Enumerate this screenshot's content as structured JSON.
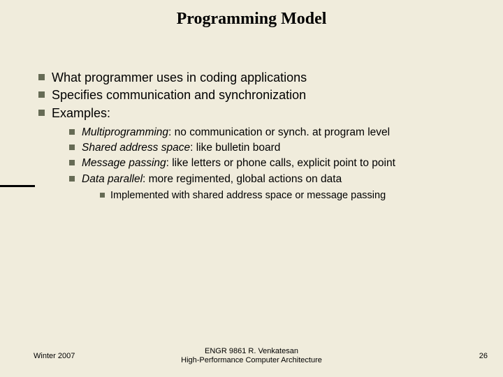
{
  "title": "Programming Model",
  "bullets": {
    "b0": "What programmer uses in coding applications",
    "b1": "Specifies communication and synchronization",
    "b2": "Examples:"
  },
  "sub": {
    "s0_lead": "Multiprogramming",
    "s0_rest": ": no communication or synch. at program level",
    "s1_lead": "Shared address space",
    "s1_rest": ": like bulletin board",
    "s2_lead": "Message passing",
    "s2_rest": ": like letters or phone calls, explicit point to point",
    "s3_lead": "Data parallel",
    "s3_rest": ": more regimented, global actions on data"
  },
  "subsub": {
    "ss0": "Implemented with shared address space or message passing"
  },
  "footer": {
    "left": "Winter 2007",
    "center_line1": "ENGR 9861   R. Venkatesan",
    "center_line2": "High-Performance Computer Architecture",
    "right": "26"
  }
}
